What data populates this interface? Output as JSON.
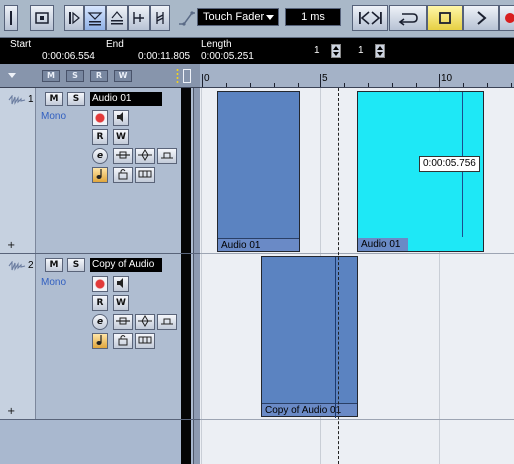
{
  "toolbar": {
    "automation_mode": "Touch Fader",
    "nudge_value": "1 ms"
  },
  "infoline": {
    "start_label": "Start",
    "start_value": "0:00:06.554",
    "end_label": "End",
    "end_value": "0:00:11.805",
    "length_label": "Length",
    "length_value": "0:00:05.251",
    "field1_value": "1",
    "field2_value": "1"
  },
  "tracklist_header": {
    "buttons": [
      "M",
      "S",
      "R",
      "W"
    ]
  },
  "ruler": {
    "labels": [
      "0",
      "5",
      "10"
    ]
  },
  "tracks": [
    {
      "number": "1",
      "name": "Audio 01",
      "channel_mode": "Mono",
      "mute_label": "M",
      "solo_label": "S",
      "read_label": "R",
      "write_label": "W",
      "edit_label": "e"
    },
    {
      "number": "2",
      "name": "Copy of Audio",
      "channel_mode": "Mono",
      "mute_label": "M",
      "solo_label": "S",
      "read_label": "R",
      "write_label": "W",
      "edit_label": "e"
    }
  ],
  "events": [
    {
      "label": "Audio 01",
      "track": 1,
      "selected": false
    },
    {
      "label": "Audio 01",
      "track": 1,
      "selected": true
    },
    {
      "label": "Copy of Audio 01",
      "track": 2,
      "selected": false
    }
  ],
  "tooltip": "0:00:05.756",
  "colors": {
    "event_normal": "#5b83c1",
    "event_selected": "#1ee8f6",
    "event_label_bg": "#6a8ac6",
    "arrange_bg": "#eceff4",
    "infoline_bg": "#000000"
  }
}
